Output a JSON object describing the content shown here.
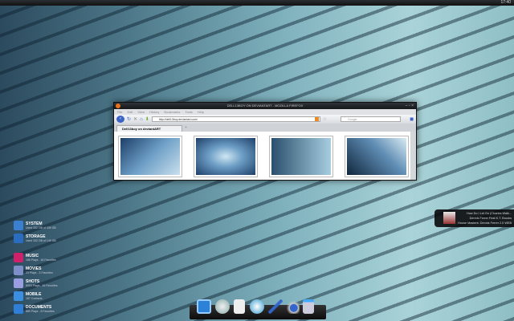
{
  "topbar": {
    "clock": "17:40"
  },
  "browser": {
    "title": "DELL13BOY ON DEVIANTART - MOZILLA FIREFOX",
    "menu": [
      "File",
      "Edit",
      "View",
      "History",
      "Bookmarks",
      "Tools",
      "Help"
    ],
    "url": "http://dell13boy.deviantart.com/",
    "search_placeholder": "Google",
    "tab": "Dell13boy on deviantART",
    "new_tab": "+",
    "window_controls": "– ▫ ×"
  },
  "sidebar": [
    {
      "title": "SYSTEM",
      "sub": "Used 332 GB of 339 GB",
      "color": "#3a7fd0"
    },
    {
      "title": "STORAGE",
      "sub": "Used 332 GB of 149 GB",
      "color": "#2a6cc0"
    },
    {
      "title": "MUSIC",
      "sub": "186 Plays - 16 Favorites",
      "color": "#d0206a"
    },
    {
      "title": "MOVIES",
      "sub": "23 Plays - 3 Favorites",
      "color": "#7d8ec8"
    },
    {
      "title": "SHOTS",
      "sub": "8053 Plays - 16 Favorites",
      "color": "#9a9ee0"
    },
    {
      "title": "MOBILE",
      "sub": "187 Contacts",
      "color": "#3c8ee0"
    },
    {
      "title": "DOCUMENTS",
      "sub": "889 Plays - 8 Favorites",
      "color": "#2f7fd8"
    }
  ],
  "now_playing": {
    "track": "How Do I Let Go (Charles Walk...",
    "artist": "Dennis Ferrer Feat K.T. Brooks",
    "album": "House Masters: Dennis Ferrer 2.0 WEB"
  },
  "dock": [
    "finder-icon",
    "safari-icon",
    "textedit-icon",
    "itunes-icon",
    "xcode-icon",
    "keychain-icon",
    "trash-icon"
  ]
}
